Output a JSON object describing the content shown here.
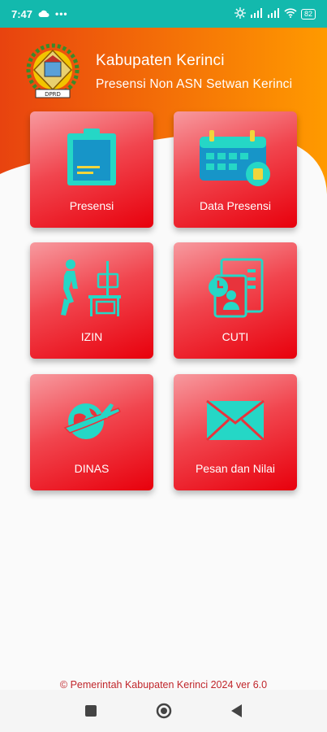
{
  "status_bar": {
    "time": "7:47",
    "battery": "82"
  },
  "header": {
    "title": "Kabupaten Kerinci",
    "subtitle": "Presensi Non ASN Setwan Kerinci",
    "gradient_start": "#e8430f",
    "gradient_end": "#ff9a00"
  },
  "menu": {
    "tile_color": "#ef3b45",
    "icon_color": "#25d7c6",
    "items": [
      {
        "label": "Presensi",
        "icon": "clipboard-icon"
      },
      {
        "label": "Data Presensi",
        "icon": "calendar-icon"
      },
      {
        "label": "IZIN",
        "icon": "walking-person-desk-icon"
      },
      {
        "label": "CUTI",
        "icon": "leave-document-icon"
      },
      {
        "label": "DINAS",
        "icon": "plane-globe-icon"
      },
      {
        "label": "Pesan dan Nilai",
        "icon": "envelope-icon"
      }
    ]
  },
  "footer": {
    "copyright": "© Pemerintah Kabupaten Kerinci 2024 ver 6.0"
  },
  "nav_bar": {
    "buttons": [
      "recents-button",
      "home-button",
      "back-button"
    ]
  }
}
